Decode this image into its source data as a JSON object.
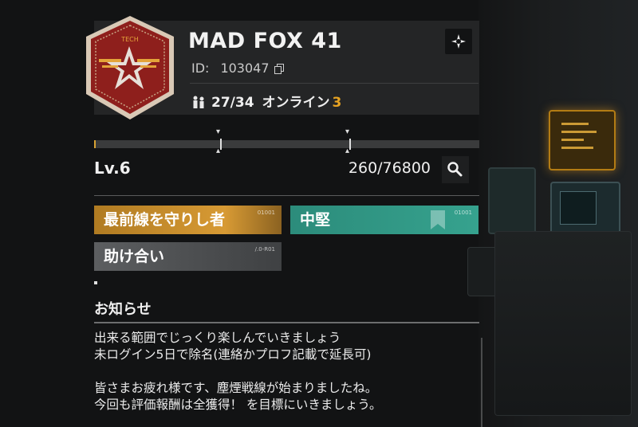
{
  "clan": {
    "name": "MAD FOX 41",
    "id_label": "ID:",
    "id_value": "103047",
    "members": "27/34",
    "online_label": "オンライン",
    "online_count": "3",
    "emblem_text": "TECH",
    "emblem_color": "#8e1f1c"
  },
  "level": {
    "label": "Lv.6",
    "xp_text": "260/76800",
    "progress": 0.004
  },
  "tags": [
    {
      "label": "最前線を守りし者",
      "code": "01001",
      "color": "#d79a34"
    },
    {
      "label": "中堅",
      "code": "01001",
      "color": "#36a28e"
    },
    {
      "label": "助け合い",
      "code": "/.0-R01",
      "color": "#5c5e60"
    }
  ],
  "notice": {
    "title": "お知らせ",
    "lines": [
      "出来る範囲でじっくり楽しんでいきましょう",
      "未ログイン5日で除名(連絡かプロフ記載で延長可)",
      "",
      "皆さまお疲れ様です、塵煙戦線が始まりましたね。",
      "今回も評価報酬は全獲得！ を目標にいきましょう。"
    ]
  },
  "icons": {
    "target": "crosshair-icon",
    "search": "search-icon",
    "copy": "copy-icon",
    "members": "members-icon"
  }
}
